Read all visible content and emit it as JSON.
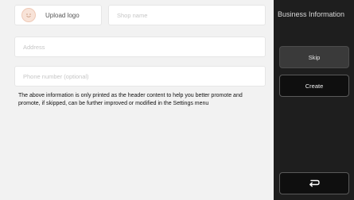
{
  "main": {
    "logo": {
      "label": "Upload logo",
      "icon": "smiley-face-icon"
    },
    "fields": {
      "shop_name_placeholder": "Shop name",
      "address_placeholder": "Address",
      "phone_placeholder": "Phone number (optional)"
    },
    "info_text": "The above information is only printed as the header content to help you better promote and promote, if skipped, can be further improved or modified in the Settings menu"
  },
  "sidebar": {
    "title": "Business Information",
    "skip_label": "Skip",
    "create_label": "Create",
    "back_icon": "return-arrow-icon"
  },
  "colors": {
    "panel_bg": "#f2f2f2",
    "sidebar_bg": "#1e1e1e",
    "field_bg": "#ffffff"
  }
}
